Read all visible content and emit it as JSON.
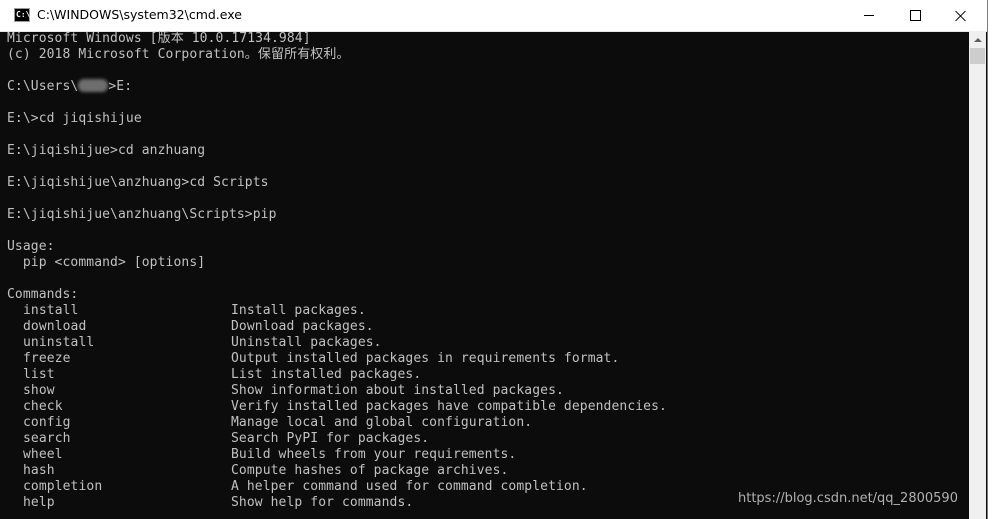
{
  "window": {
    "title": "C:\\WINDOWS\\system32\\cmd.exe",
    "icon": "cmd-app-icon",
    "icon_text": "C:\\"
  },
  "console": {
    "header": [
      "Microsoft Windows [版本 10.0.17134.984]",
      "(c) 2018 Microsoft Corporation。保留所有权利。"
    ],
    "prompt1_prefix": "C:\\Users\\",
    "prompt1_suffix": ">E:",
    "commands": [
      "E:\\>cd jiqishijue",
      "E:\\jiqishijue>cd anzhuang",
      "E:\\jiqishijue\\anzhuang>cd Scripts",
      "E:\\jiqishijue\\anzhuang\\Scripts>pip"
    ],
    "usage_label": "Usage:",
    "usage_line": "  pip <command> [options]",
    "commands_label": "Commands:",
    "pip_commands": [
      {
        "name": "install",
        "desc": "Install packages."
      },
      {
        "name": "download",
        "desc": "Download packages."
      },
      {
        "name": "uninstall",
        "desc": "Uninstall packages."
      },
      {
        "name": "freeze",
        "desc": "Output installed packages in requirements format."
      },
      {
        "name": "list",
        "desc": "List installed packages."
      },
      {
        "name": "show",
        "desc": "Show information about installed packages."
      },
      {
        "name": "check",
        "desc": "Verify installed packages have compatible dependencies."
      },
      {
        "name": "config",
        "desc": "Manage local and global configuration."
      },
      {
        "name": "search",
        "desc": "Search PyPI for packages."
      },
      {
        "name": "wheel",
        "desc": "Build wheels from your requirements."
      },
      {
        "name": "hash",
        "desc": "Compute hashes of package archives."
      },
      {
        "name": "completion",
        "desc": "A helper command used for command completion."
      },
      {
        "name": "help",
        "desc": "Show help for commands."
      }
    ]
  },
  "watermark": "https://blog.csdn.net/qq_2800590",
  "colors": {
    "console_bg": "#0c0c0c",
    "console_text": "#c0c0c0",
    "titlebar_bg": "#ffffff"
  }
}
